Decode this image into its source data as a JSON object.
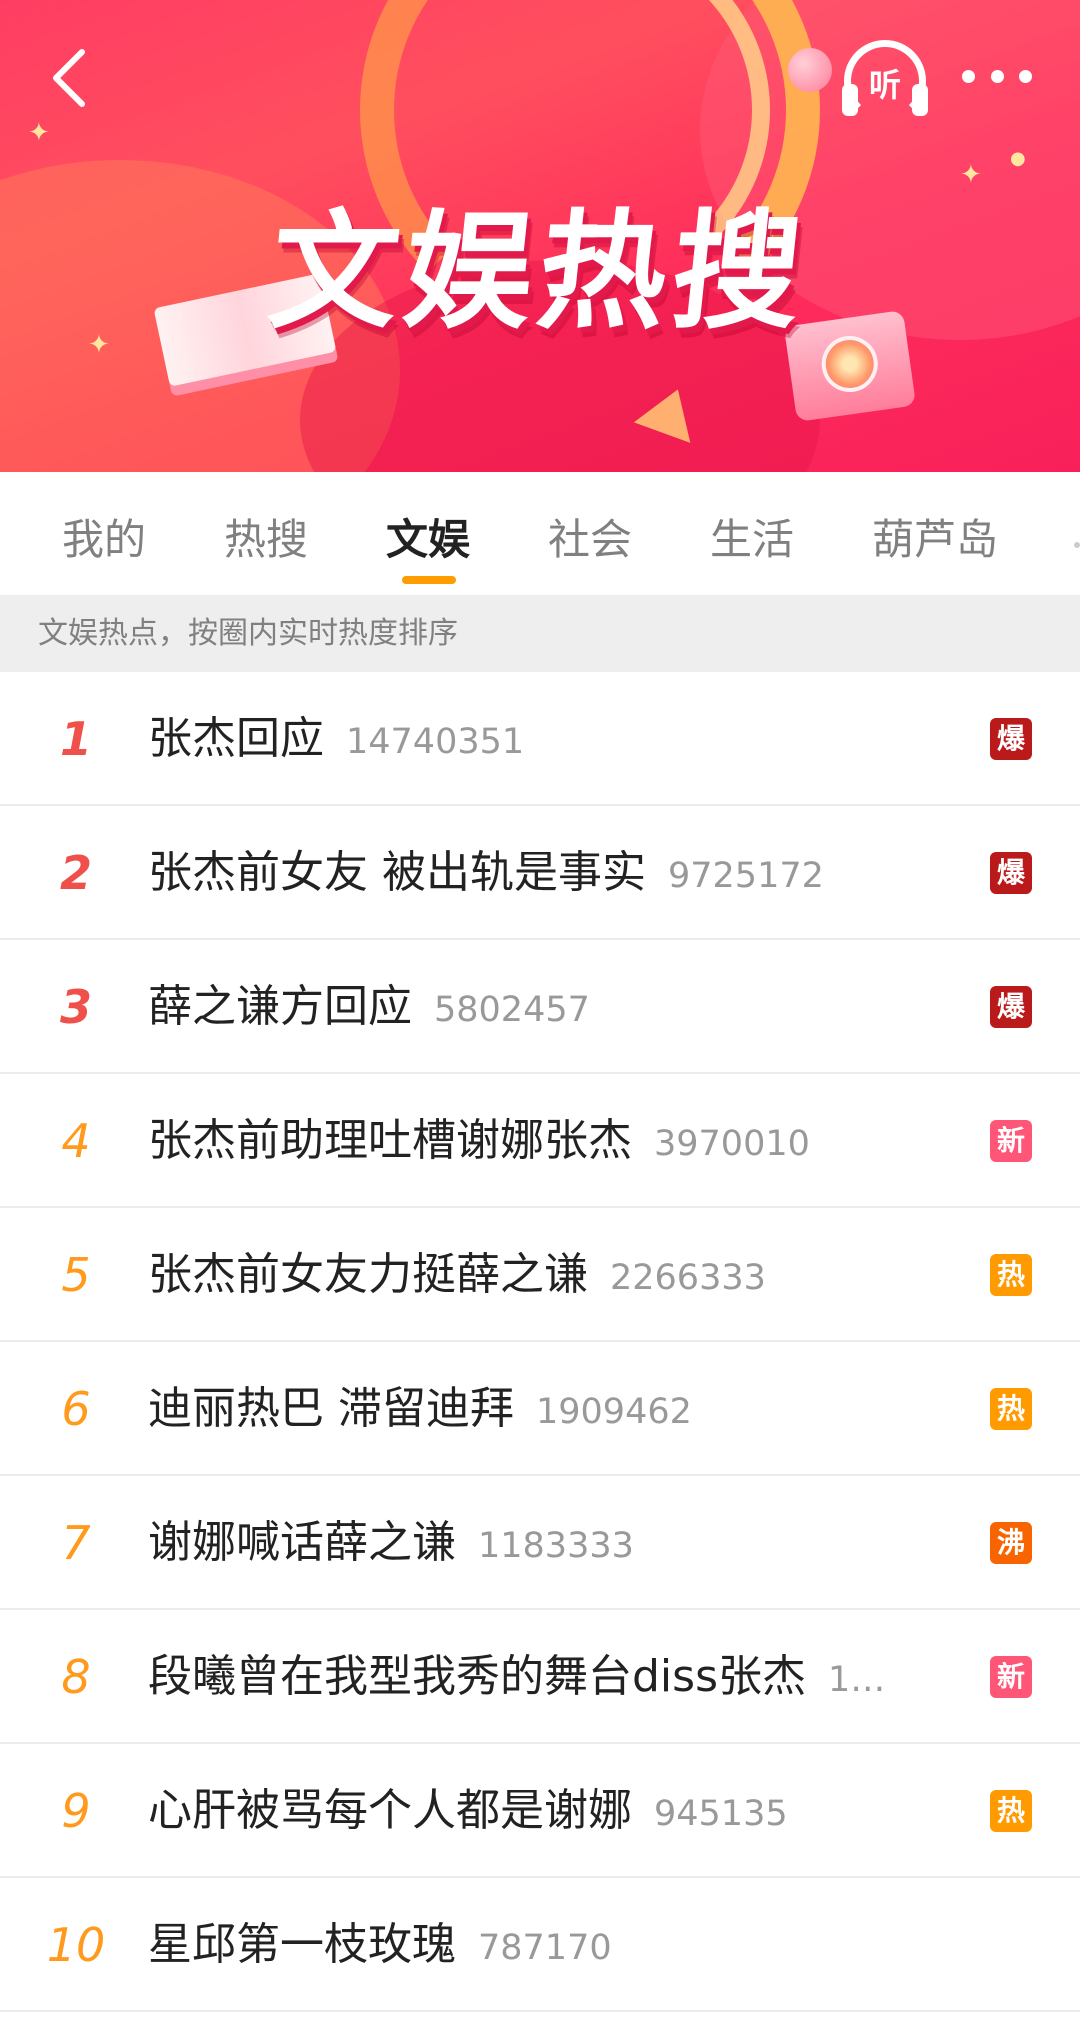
{
  "header": {
    "title": "文娱热搜",
    "listen_label": "听"
  },
  "tabs": [
    {
      "label": "我的",
      "active": false
    },
    {
      "label": "热搜",
      "active": false
    },
    {
      "label": "文娱",
      "active": true
    },
    {
      "label": "社会",
      "active": false
    },
    {
      "label": "生活",
      "active": false
    },
    {
      "label": "葫芦岛",
      "active": false
    }
  ],
  "hint": "文娱热点，按圈内实时热度排序",
  "badge_colors": {
    "爆": "#bb1a1a",
    "新": "#ff5577",
    "热": "#ff9a00",
    "沸": "#f86400"
  },
  "list": [
    {
      "rank": "1",
      "title": "张杰回应",
      "count": "14740351",
      "badge": "爆"
    },
    {
      "rank": "2",
      "title": "张杰前女友 被出轨是事实",
      "count": "9725172",
      "badge": "爆"
    },
    {
      "rank": "3",
      "title": "薛之谦方回应",
      "count": "5802457",
      "badge": "爆"
    },
    {
      "rank": "4",
      "title": "张杰前助理吐槽谢娜张杰",
      "count": "3970010",
      "badge": "新"
    },
    {
      "rank": "5",
      "title": "张杰前女友力挺薛之谦",
      "count": "2266333",
      "badge": "热"
    },
    {
      "rank": "6",
      "title": "迪丽热巴 滞留迪拜",
      "count": "1909462",
      "badge": "热"
    },
    {
      "rank": "7",
      "title": "谢娜喊话薛之谦",
      "count": "1183333",
      "badge": "沸"
    },
    {
      "rank": "8",
      "title": "段曦曾在我型我秀的舞台diss张杰",
      "count": "1…",
      "badge": "新"
    },
    {
      "rank": "9",
      "title": "心肝被骂每个人都是谢娜",
      "count": "945135",
      "badge": "热"
    },
    {
      "rank": "10",
      "title": "星邱第一枝玫瑰",
      "count": "787170",
      "badge": ""
    }
  ]
}
